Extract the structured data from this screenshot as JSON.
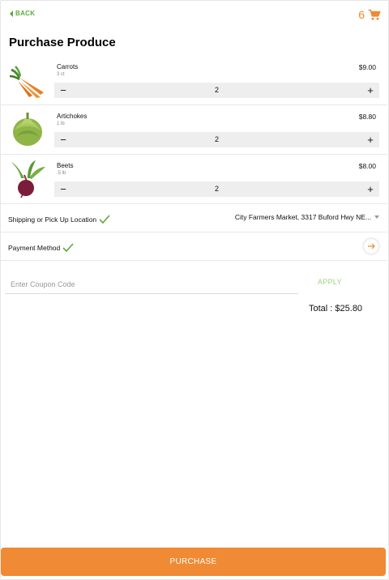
{
  "header": {
    "back_label": "BACK",
    "cart_count": "6",
    "cart_icon": "shopping-cart-icon"
  },
  "page": {
    "title": "Purchase Produce"
  },
  "items": [
    {
      "name": "Carrots",
      "unit": "3 ct",
      "price": "$9.00",
      "quantity": "2",
      "image": "carrots-image"
    },
    {
      "name": "Artichokes",
      "unit": "1 lb",
      "price": "$8.80",
      "quantity": "2",
      "image": "artichoke-image"
    },
    {
      "name": "Beets",
      "unit": ".5 lb",
      "price": "$8.00",
      "quantity": "2",
      "image": "beet-image"
    }
  ],
  "stepper": {
    "minus": "−",
    "plus": "+"
  },
  "shipping": {
    "label": "Shipping or Pick Up Location",
    "value": "City Farmers Market, 3317 Buford Hwy NE..."
  },
  "payment": {
    "label": "Payment Method"
  },
  "coupon": {
    "placeholder": "Enter Coupon Code",
    "apply_label": "APPLY"
  },
  "total": "Total : $25.80",
  "purchase_label": "PURCHASE",
  "colors": {
    "accent": "#f08a34",
    "green": "#5fa83a",
    "apply_green": "#9fd17f",
    "stepper_bg": "#eeeeee"
  }
}
